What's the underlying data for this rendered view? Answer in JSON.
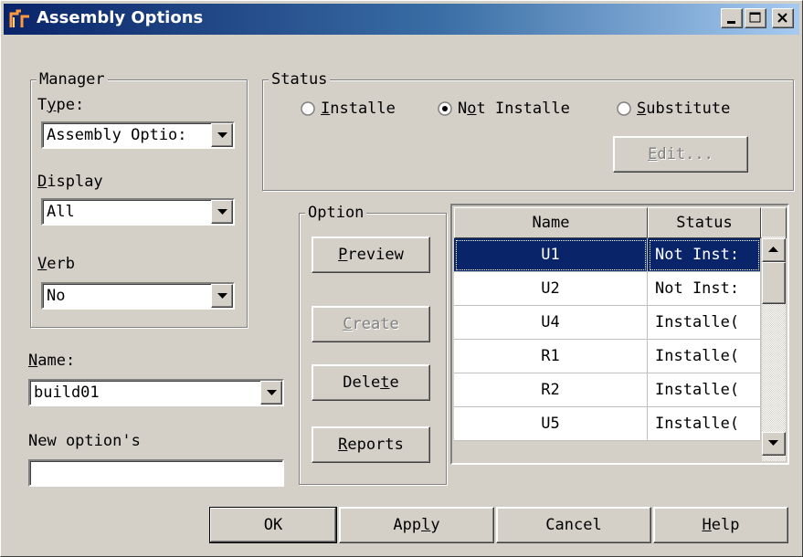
{
  "window": {
    "title": "Assembly Options",
    "controls": [
      "minimize-icon",
      "maximize-icon",
      "close-icon"
    ]
  },
  "manager": {
    "legend": "Manager",
    "type_label_pre": "T",
    "type_label_ul": "y",
    "type_label_post": "pe:",
    "type_value": "Assembly Optio:",
    "display_label_ul": "D",
    "display_label_post": "isplay",
    "display_value": "All",
    "verb_label_ul": "V",
    "verb_label_post": "erb",
    "verb_value": "No"
  },
  "name": {
    "label_ul": "N",
    "label_post": "ame:",
    "value": "build01"
  },
  "new_option": {
    "label": "New option's",
    "value": ""
  },
  "status": {
    "legend": "Status",
    "installed_ul": "I",
    "installed_post": "nstalle",
    "not_installed_pre": "N",
    "not_installed_ul": "o",
    "not_installed_post": "t Installe",
    "substitute_ul": "S",
    "substitute_post": "ubstitute",
    "selected": "not_installed",
    "edit_ul": "E",
    "edit_post": "dit..."
  },
  "option": {
    "legend": "Option",
    "preview_ul": "P",
    "preview_post": "review",
    "create_ul": "C",
    "create_post": "reate",
    "delete_pre": "Dele",
    "delete_ul": "t",
    "delete_post": "e",
    "reports_ul": "R",
    "reports_post": "eports"
  },
  "grid": {
    "col_name": "Name",
    "col_status": "Status",
    "rows": [
      {
        "name": "U1",
        "status": "Not Inst:",
        "selected": true
      },
      {
        "name": "U2",
        "status": "Not Inst:"
      },
      {
        "name": "U4",
        "status": "Installe("
      },
      {
        "name": "R1",
        "status": "Installe("
      },
      {
        "name": "R2",
        "status": "Installe("
      },
      {
        "name": "U5",
        "status": "Installe("
      }
    ]
  },
  "buttons": {
    "ok": "OK",
    "apply_pre": "App",
    "apply_ul": "l",
    "apply_post": "y",
    "cancel": "Cancel",
    "help_ul": "H",
    "help_post": "elp"
  },
  "colors": {
    "face": "#d4d0c8",
    "title_dark": "#0a246a",
    "title_light": "#a6caf0",
    "selection": "#0a246a"
  }
}
